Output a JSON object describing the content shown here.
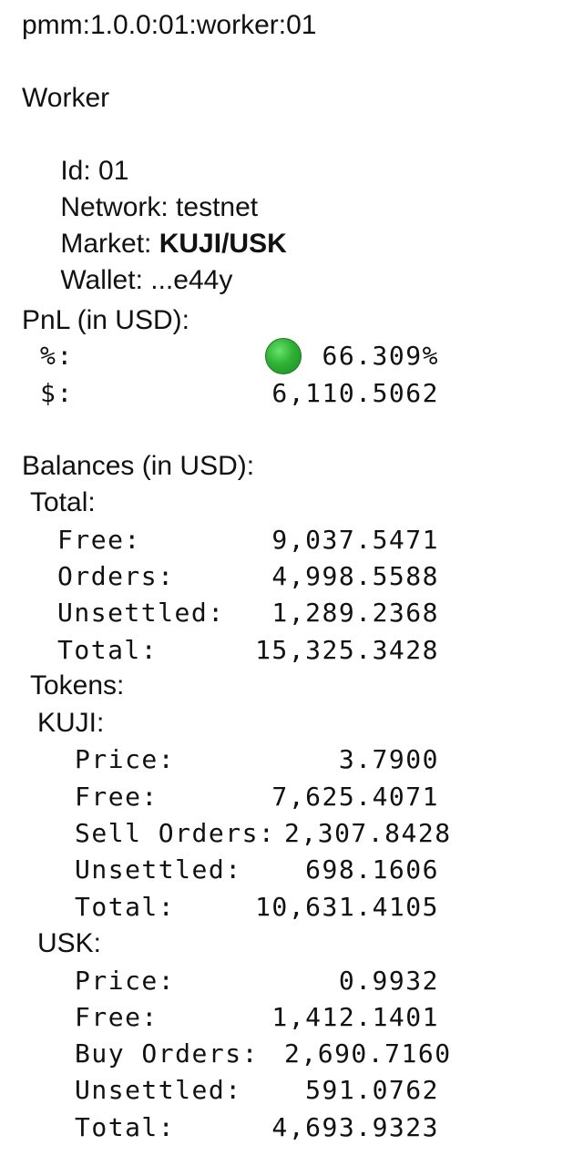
{
  "title": "pmm:1.0.0:01:worker:01",
  "worker": {
    "heading": "Worker",
    "id_label": "Id:",
    "id_value": "01",
    "network_label": "Network:",
    "network_value": "testnet",
    "market_label": "Market:",
    "market_value": "KUJI/USK",
    "wallet_label": "Wallet:",
    "wallet_value": "...e44y"
  },
  "pnl": {
    "heading": "PnL (in USD):",
    "percent_label": "%:",
    "percent_value": "66.309%",
    "status_icon_color": "#2fb135",
    "usd_label": "$:",
    "usd_value": "6,110.5062"
  },
  "balances": {
    "heading": "Balances (in USD):",
    "total": {
      "heading": "Total:",
      "rows": [
        {
          "label": "Free:",
          "value": "9,037.5471"
        },
        {
          "label": "Orders:",
          "value": "4,998.5588"
        },
        {
          "label": "Unsettled:",
          "value": "1,289.2368"
        },
        {
          "label": "Total:",
          "value": "15,325.3428"
        }
      ]
    },
    "tokens_heading": "Tokens:",
    "tokens": [
      {
        "name": "KUJI:",
        "rows": [
          {
            "label": "Price:",
            "value": "3.7900"
          },
          {
            "label": "Free:",
            "value": "7,625.4071"
          },
          {
            "label": "Sell Orders:",
            "value": "2,307.8428"
          },
          {
            "label": "Unsettled:",
            "value": "698.1606"
          },
          {
            "label": "Total:",
            "value": "10,631.4105"
          }
        ]
      },
      {
        "name": "USK:",
        "rows": [
          {
            "label": "Price:",
            "value": "0.9932"
          },
          {
            "label": "Free:",
            "value": "1,412.1401"
          },
          {
            "label": "Buy Orders:",
            "value": "2,690.7160"
          },
          {
            "label": "Unsettled:",
            "value": "591.0762"
          },
          {
            "label": "Total:",
            "value": "4,693.9323"
          }
        ]
      }
    ]
  }
}
